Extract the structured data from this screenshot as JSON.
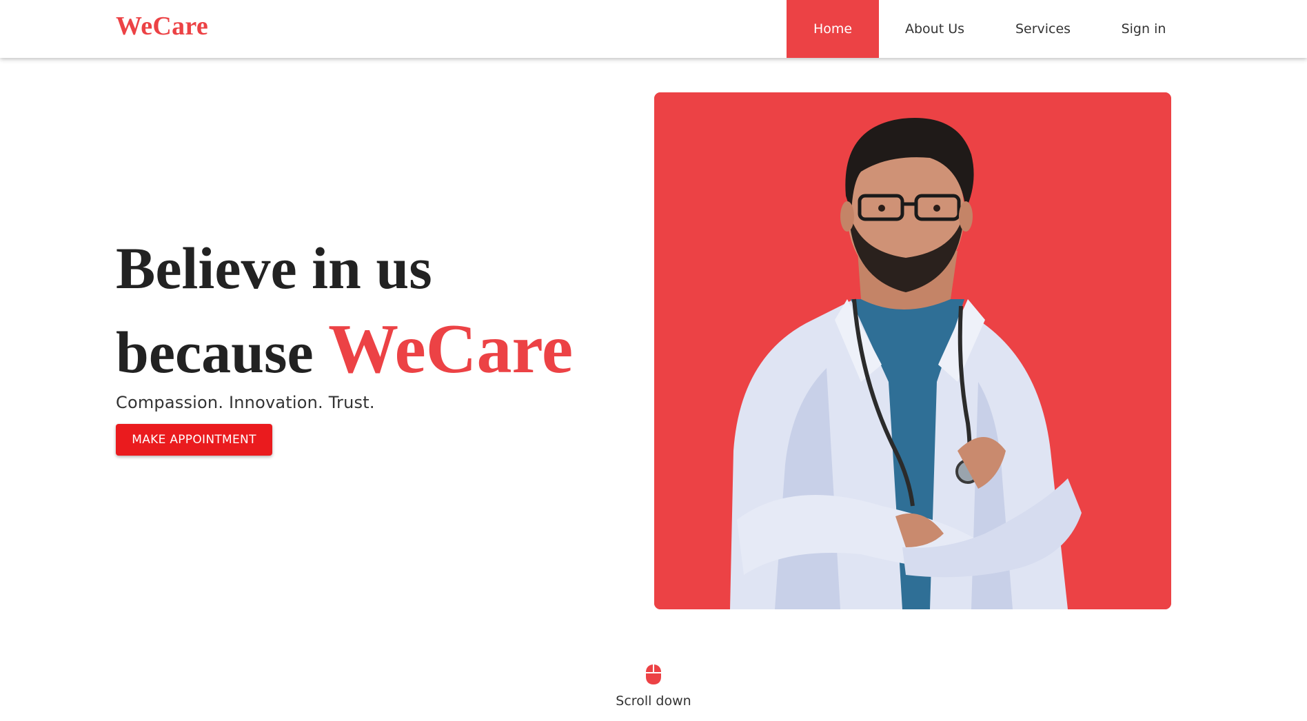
{
  "brand": {
    "name": "WeCare",
    "color": "#ec4245"
  },
  "nav": {
    "items": [
      {
        "label": "Home",
        "active": true
      },
      {
        "label": "About Us",
        "active": false
      },
      {
        "label": "Services",
        "active": false
      },
      {
        "label": "Sign in",
        "active": false
      }
    ]
  },
  "hero": {
    "line1": "Believe in us",
    "line2_prefix": "because",
    "line2_brand": "WeCare",
    "tagline": "Compassion. Innovation. Trust.",
    "cta_label": "MAKE APPOINTMENT",
    "image_subject": "doctor-portrait",
    "image_background": "#ec4245"
  },
  "scroll_hint": {
    "icon": "mouse-icon",
    "label": "Scroll down"
  }
}
